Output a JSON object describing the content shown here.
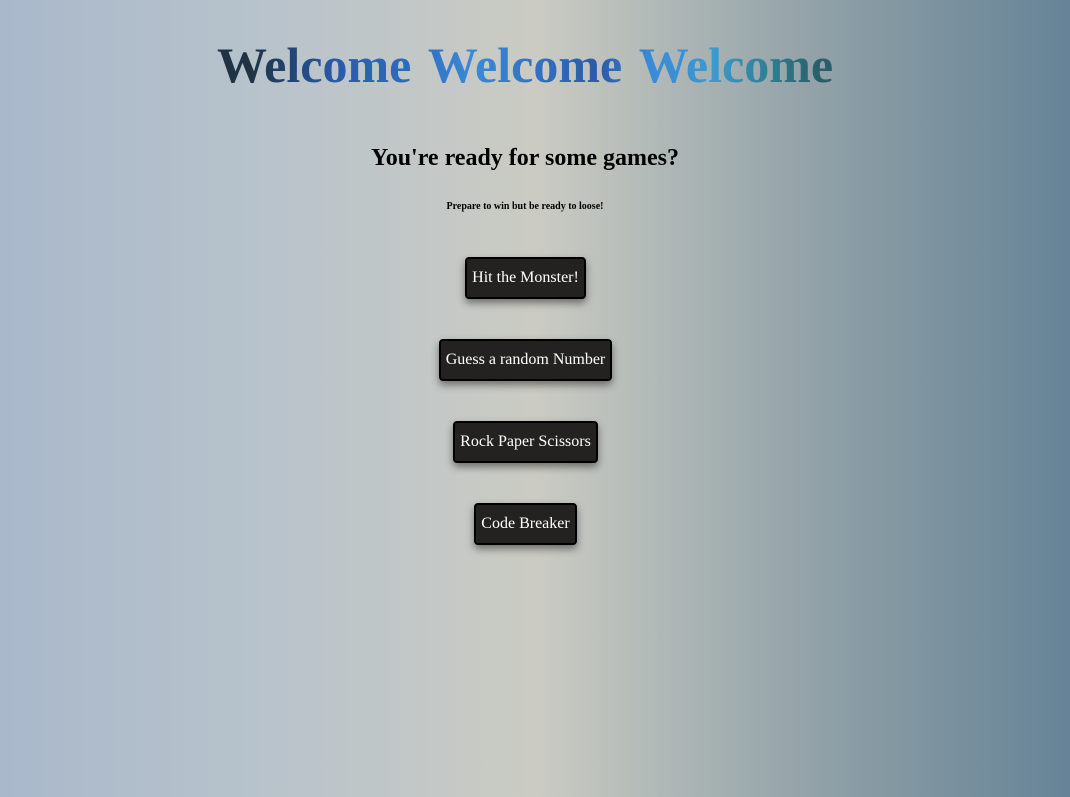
{
  "header": {
    "welcome_words": [
      "Welcome",
      "Welcome",
      "Welcome"
    ],
    "subtitle": "You're ready for some games?",
    "tagline": "Prepare to win but be ready to loose!"
  },
  "games": {
    "hit_monster": "Hit the Monster!",
    "guess_number": "Guess a random Number",
    "rock_paper_scissors": "Rock Paper Scissors",
    "code_breaker": "Code Breaker"
  },
  "colors": {
    "button_bg": "#232221",
    "button_text": "#ffffff"
  }
}
